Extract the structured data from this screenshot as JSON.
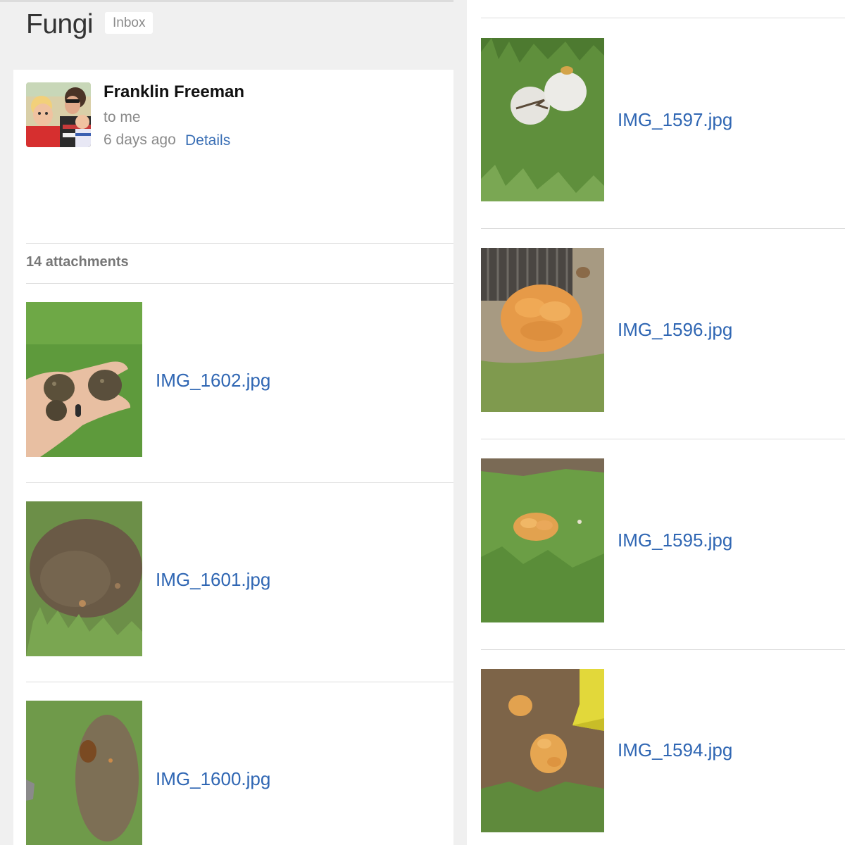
{
  "header": {
    "subject": "Fungi",
    "label": "Inbox"
  },
  "message": {
    "sender": "Franklin Freeman",
    "recipient": "to me",
    "time": "6 days ago",
    "details_label": "Details"
  },
  "attachments": {
    "count_label": "14 attachments",
    "items": [
      {
        "filename": "IMG_1602.jpg",
        "thumb": "hand-holding-mushrooms"
      },
      {
        "filename": "IMG_1601.jpg",
        "thumb": "dirt-patch-in-grass"
      },
      {
        "filename": "IMG_1600.jpg",
        "thumb": "brown-mushroom-in-grass"
      },
      {
        "filename": "IMG_1597.jpg",
        "thumb": "white-puffballs-in-grass"
      },
      {
        "filename": "IMG_1596.jpg",
        "thumb": "orange-mushroom-cluster"
      },
      {
        "filename": "IMG_1595.jpg",
        "thumb": "small-orange-cluster-in-grass"
      },
      {
        "filename": "IMG_1594.jpg",
        "thumb": "orange-clusters-near-yellow-object"
      }
    ]
  }
}
